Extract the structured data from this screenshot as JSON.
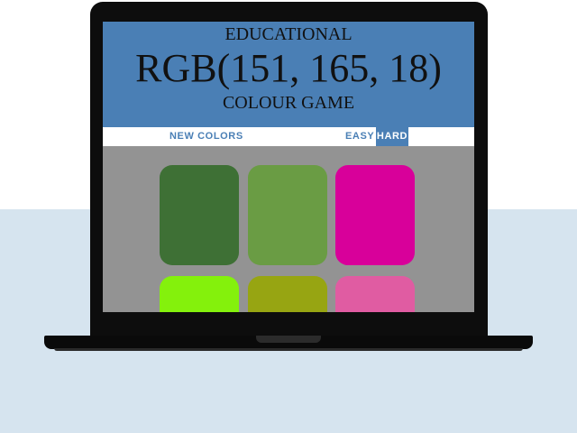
{
  "header": {
    "title_top": "EDUCATIONAL",
    "rgb_target": "RGB(151, 165, 18)",
    "title_bottom": "COLOUR GAME"
  },
  "nav": {
    "new_colors": "NEW COLORS",
    "easy": "EASY",
    "hard": "HARD",
    "selected_mode": "HARD"
  },
  "colors": {
    "header_bg": "#4a7fb5",
    "game_bg": "#939393",
    "accent": "#4a7fb5"
  },
  "squares": [
    {
      "color": "#3e7035"
    },
    {
      "color": "#6a9c44"
    },
    {
      "color": "#d8009a"
    },
    {
      "color": "#84f10c"
    },
    {
      "color": "#97a512"
    },
    {
      "color": "#e05ca2"
    }
  ]
}
